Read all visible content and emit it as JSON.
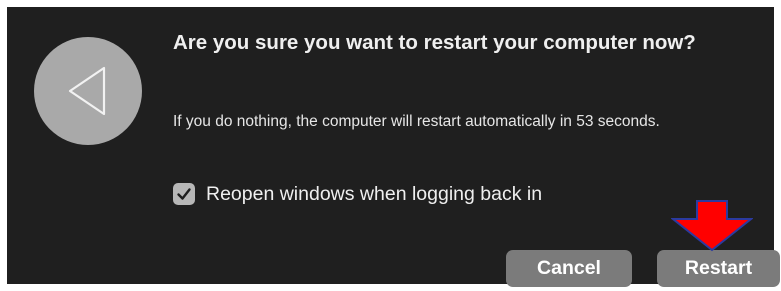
{
  "dialog": {
    "icon": "back-triangle-icon",
    "title": "Are you sure you want to restart your computer now?",
    "message": "If you do nothing, the computer will restart automatically in 53 seconds.",
    "checkbox": {
      "label": "Reopen windows when logging back in",
      "checked": true
    },
    "buttons": {
      "cancel_label": "Cancel",
      "restart_label": "Restart"
    }
  },
  "colors": {
    "background": "#1f1f1f",
    "button": "#7b7b7b",
    "icon_circle": "#a9a9a9",
    "annotation_arrow_fill": "#ff0000",
    "annotation_arrow_outline": "#2b3aa0"
  },
  "annotation": {
    "icon": "red-down-arrow-icon"
  }
}
